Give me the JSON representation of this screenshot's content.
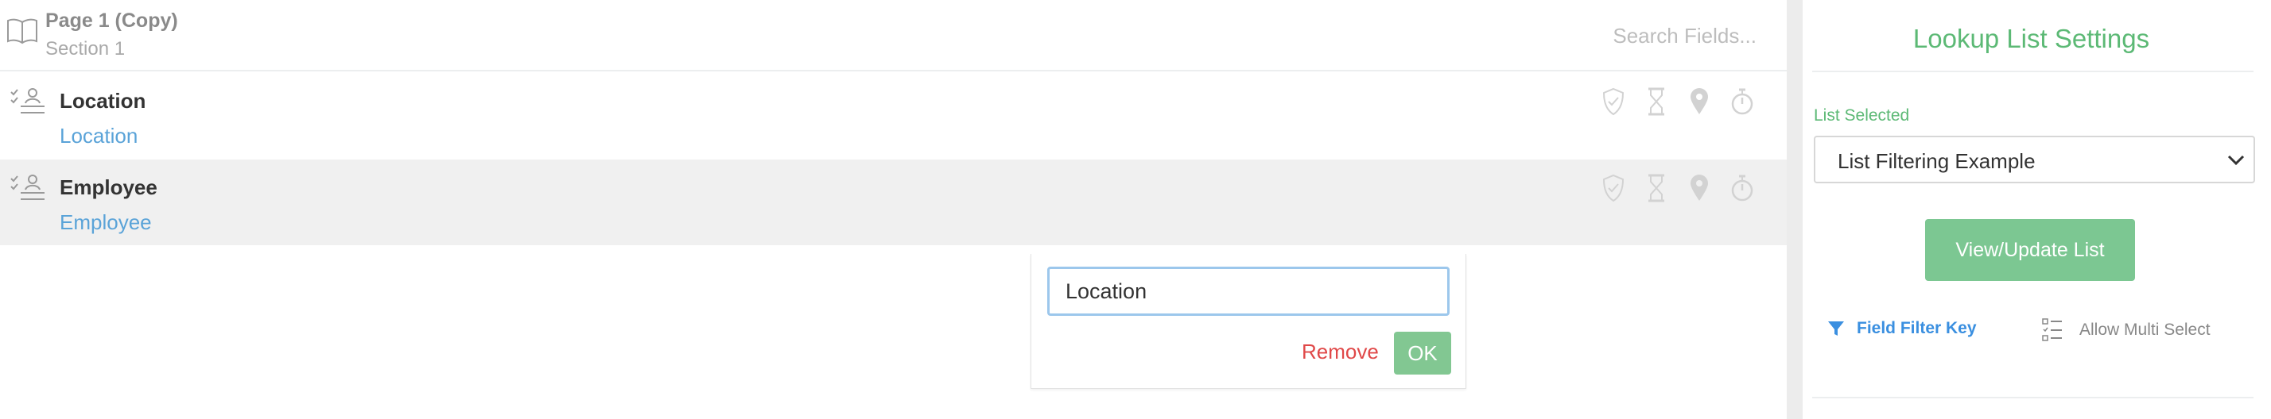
{
  "header": {
    "page_title": "Page 1 (Copy)",
    "section_name": "Section 1",
    "search_placeholder": "Search Fields..."
  },
  "fields": [
    {
      "name": "Location",
      "sublabel": "Location"
    },
    {
      "name": "Employee",
      "sublabel": "Employee"
    }
  ],
  "popup": {
    "input_value": "Location",
    "remove_label": "Remove",
    "ok_label": "OK"
  },
  "settings": {
    "title": "Lookup List Settings",
    "list_label": "List Selected",
    "list_value": "List Filtering Example",
    "view_button_label": "View/Update List",
    "filter_key_label": "Field Filter Key",
    "multi_select_label": "Allow Multi Select"
  },
  "colors": {
    "accent_green": "#5cb975",
    "button_green": "#7cc792",
    "link_blue": "#5aa3d8",
    "filter_blue": "#3a8fe0",
    "remove_red": "#e04848"
  },
  "icons": {
    "header": "book-icon",
    "row_type": "checklist-person-icon",
    "row_actions": [
      "shield-icon",
      "hourglass-icon",
      "location-pin-icon",
      "stopwatch-icon"
    ],
    "filter": "filter-icon",
    "multi_select": "checklist-icon",
    "select_arrow": "chevron-down-icon"
  }
}
